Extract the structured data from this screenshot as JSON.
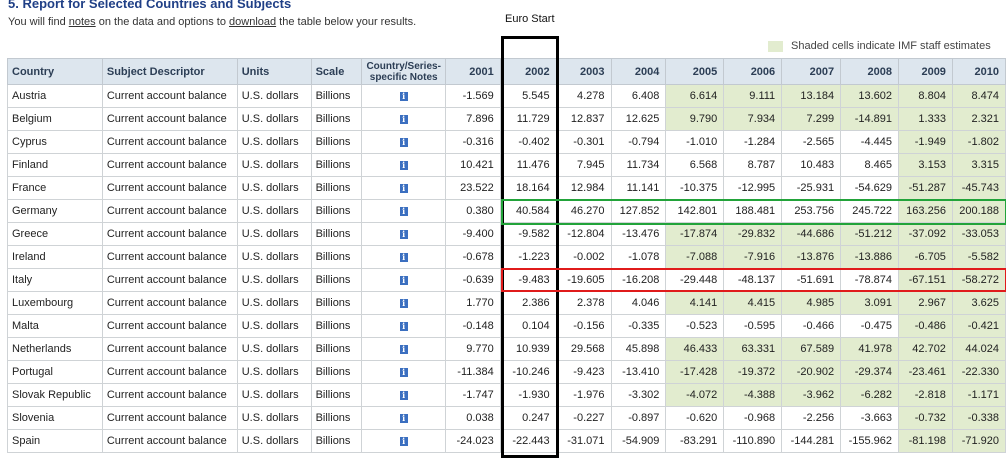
{
  "header": {
    "title": "5. Report for Selected Countries and Subjects",
    "sub_prefix": "You will find",
    "sub_notes_link": "notes",
    "sub_mid": "on the data and options to",
    "sub_download_link": "download",
    "sub_suffix": "the table below your results."
  },
  "annotation": {
    "euro_start": "Euro Start"
  },
  "shading_note": "Shaded cells indicate IMF staff estimates",
  "colors": {
    "header_bg": "#dde6ee",
    "shaded": "#e2eccf",
    "germany_box": "#22a33a",
    "italy_box": "#e01b1b",
    "info_icon": "#3b6fc0"
  },
  "icons": {
    "notes": "info-icon"
  },
  "columns": [
    "Country",
    "Subject Descriptor",
    "Units",
    "Scale",
    "Country/Series-specific Notes",
    "2001",
    "2002",
    "2003",
    "2004",
    "2005",
    "2006",
    "2007",
    "2008",
    "2009",
    "2010"
  ],
  "rows": [
    {
      "country": "Austria",
      "subject": "Current account balance",
      "units": "U.S. dollars",
      "scale": "Billions",
      "values": [
        "-1.569",
        "5.545",
        "4.278",
        "6.408",
        "6.614",
        "9.111",
        "13.184",
        "13.602",
        "8.804",
        "8.474"
      ],
      "shade_from": 4
    },
    {
      "country": "Belgium",
      "subject": "Current account balance",
      "units": "U.S. dollars",
      "scale": "Billions",
      "values": [
        "7.896",
        "11.729",
        "12.837",
        "12.625",
        "9.790",
        "7.934",
        "7.299",
        "-14.891",
        "1.333",
        "2.321"
      ],
      "shade_from": 4
    },
    {
      "country": "Cyprus",
      "subject": "Current account balance",
      "units": "U.S. dollars",
      "scale": "Billions",
      "values": [
        "-0.316",
        "-0.402",
        "-0.301",
        "-0.794",
        "-1.010",
        "-1.284",
        "-2.565",
        "-4.445",
        "-1.949",
        "-1.802"
      ],
      "shade_from": 8
    },
    {
      "country": "Finland",
      "subject": "Current account balance",
      "units": "U.S. dollars",
      "scale": "Billions",
      "values": [
        "10.421",
        "11.476",
        "7.945",
        "11.734",
        "6.568",
        "8.787",
        "10.483",
        "8.465",
        "3.153",
        "3.315"
      ],
      "shade_from": 8
    },
    {
      "country": "France",
      "subject": "Current account balance",
      "units": "U.S. dollars",
      "scale": "Billions",
      "values": [
        "23.522",
        "18.164",
        "12.984",
        "11.141",
        "-10.375",
        "-12.995",
        "-25.931",
        "-54.629",
        "-51.287",
        "-45.743"
      ],
      "shade_from": 8
    },
    {
      "country": "Germany",
      "subject": "Current account balance",
      "units": "U.S. dollars",
      "scale": "Billions",
      "values": [
        "0.380",
        "40.584",
        "46.270",
        "127.852",
        "142.801",
        "188.481",
        "253.756",
        "245.722",
        "163.256",
        "200.188"
      ],
      "shade_from": 8
    },
    {
      "country": "Greece",
      "subject": "Current account balance",
      "units": "U.S. dollars",
      "scale": "Billions",
      "values": [
        "-9.400",
        "-9.582",
        "-12.804",
        "-13.476",
        "-17.874",
        "-29.832",
        "-44.686",
        "-51.212",
        "-37.092",
        "-33.053"
      ],
      "shade_from": 4
    },
    {
      "country": "Ireland",
      "subject": "Current account balance",
      "units": "U.S. dollars",
      "scale": "Billions",
      "values": [
        "-0.678",
        "-1.223",
        "-0.002",
        "-1.078",
        "-7.088",
        "-7.916",
        "-13.876",
        "-13.886",
        "-6.705",
        "-5.582"
      ],
      "shade_from": 4
    },
    {
      "country": "Italy",
      "subject": "Current account balance",
      "units": "U.S. dollars",
      "scale": "Billions",
      "values": [
        "-0.639",
        "-9.483",
        "-19.605",
        "-16.208",
        "-29.448",
        "-48.137",
        "-51.691",
        "-78.874",
        "-67.151",
        "-58.272"
      ],
      "shade_from": 8
    },
    {
      "country": "Luxembourg",
      "subject": "Current account balance",
      "units": "U.S. dollars",
      "scale": "Billions",
      "values": [
        "1.770",
        "2.386",
        "2.378",
        "4.046",
        "4.141",
        "4.415",
        "4.985",
        "3.091",
        "2.967",
        "3.625"
      ],
      "shade_from": 4
    },
    {
      "country": "Malta",
      "subject": "Current account balance",
      "units": "U.S. dollars",
      "scale": "Billions",
      "values": [
        "-0.148",
        "0.104",
        "-0.156",
        "-0.335",
        "-0.523",
        "-0.595",
        "-0.466",
        "-0.475",
        "-0.486",
        "-0.421"
      ],
      "shade_from": 8
    },
    {
      "country": "Netherlands",
      "subject": "Current account balance",
      "units": "U.S. dollars",
      "scale": "Billions",
      "values": [
        "9.770",
        "10.939",
        "29.568",
        "45.898",
        "46.433",
        "63.331",
        "67.589",
        "41.978",
        "42.702",
        "44.024"
      ],
      "shade_from": 4
    },
    {
      "country": "Portugal",
      "subject": "Current account balance",
      "units": "U.S. dollars",
      "scale": "Billions",
      "values": [
        "-11.384",
        "-10.246",
        "-9.423",
        "-13.410",
        "-17.428",
        "-19.372",
        "-20.902",
        "-29.374",
        "-23.461",
        "-22.330"
      ],
      "shade_from": 4
    },
    {
      "country": "Slovak Republic",
      "subject": "Current account balance",
      "units": "U.S. dollars",
      "scale": "Billions",
      "values": [
        "-1.747",
        "-1.930",
        "-1.976",
        "-3.302",
        "-4.072",
        "-4.388",
        "-3.962",
        "-6.282",
        "-2.818",
        "-1.171"
      ],
      "shade_from": 4
    },
    {
      "country": "Slovenia",
      "subject": "Current account balance",
      "units": "U.S. dollars",
      "scale": "Billions",
      "values": [
        "0.038",
        "0.247",
        "-0.227",
        "-0.897",
        "-0.620",
        "-0.968",
        "-2.256",
        "-3.663",
        "-0.732",
        "-0.338"
      ],
      "shade_from": 8
    },
    {
      "country": "Spain",
      "subject": "Current account balance",
      "units": "U.S. dollars",
      "scale": "Billions",
      "values": [
        "-24.023",
        "-22.443",
        "-31.071",
        "-54.909",
        "-83.291",
        "-110.890",
        "-144.281",
        "-155.962",
        "-81.198",
        "-71.920"
      ],
      "shade_from": 8
    }
  ]
}
